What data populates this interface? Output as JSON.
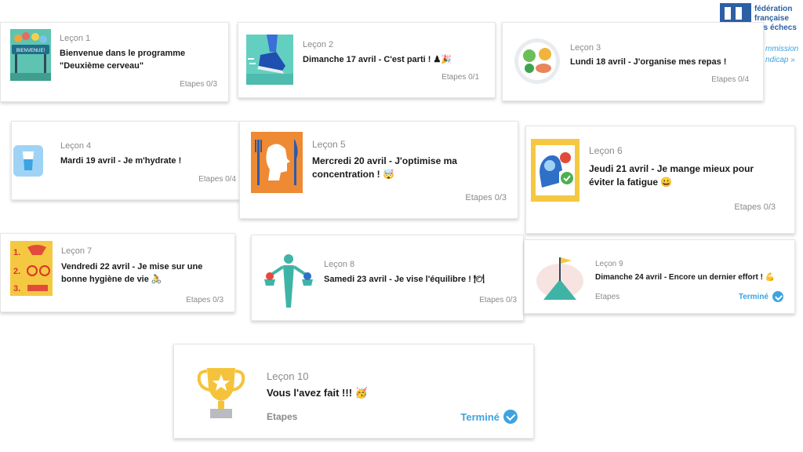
{
  "logo": {
    "line1": "fédération",
    "line2": "française",
    "line3": "des échecs",
    "sub1": "mmission",
    "sub2": "ndicap »"
  },
  "lessons": [
    {
      "lesson": "Leçon 1",
      "title": "Bienvenue dans le programme \"Deuxième cerveau\"",
      "steps": "Etapes 0/3",
      "thumb": "bienvenue-banner"
    },
    {
      "lesson": "Leçon 2",
      "title": "Dimanche 17 avril - C'est parti ! ♟🎉",
      "steps": "Etapes 0/1",
      "thumb": "running-shoe"
    },
    {
      "lesson": "Leçon 3",
      "title": "Lundi 18 avril - J'organise mes repas !",
      "steps": "Etapes 0/4",
      "thumb": "meal-plate"
    },
    {
      "lesson": "Leçon 4",
      "title": "Mardi 19 avril - Je m'hydrate !",
      "steps": "Etapes 0/4",
      "thumb": "water-glass"
    },
    {
      "lesson": "Leçon 5",
      "title": "Mercredi 20 avril - J'optimise ma concentration ! 🤯",
      "steps": "Etapes 0/3",
      "thumb": "head-cutlery"
    },
    {
      "lesson": "Leçon 6",
      "title": "Jeudi 21 avril - Je mange mieux pour éviter la fatigue 😀",
      "steps": "Etapes 0/3",
      "thumb": "brain-apple"
    },
    {
      "lesson": "Leçon 7",
      "title": "Vendredi 22 avril - Je mise sur une bonne hygiène de vie 🚴",
      "steps": "Etapes 0/3",
      "thumb": "hygiene-list"
    },
    {
      "lesson": "Leçon 8",
      "title": "Samedi 23 avril - Je vise l'équilibre ! 🍽",
      "steps": "Etapes 0/3",
      "thumb": "balance-person"
    },
    {
      "lesson": "Leçon 9",
      "title": "Dimanche 24 avril - Encore un dernier effort ! 💪",
      "steps": "Etapes",
      "done": "Terminé",
      "thumb": "mountain-flag"
    },
    {
      "lesson": "Leçon 10",
      "title": "Vous l'avez fait !!! 🥳",
      "steps": "Etapes",
      "done": "Terminé",
      "thumb": "trophy"
    }
  ],
  "colors": {
    "accent": "#3ea3e0",
    "muted": "#8a8a8a",
    "logo": "#2d5fa4"
  }
}
